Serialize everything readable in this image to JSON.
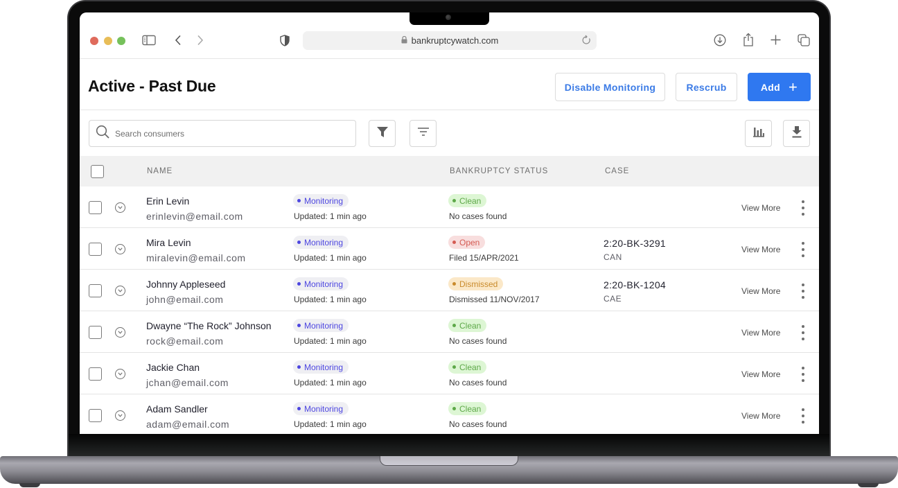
{
  "browser": {
    "url": "bankruptcywatch.com",
    "icons": {
      "sidebar": "sidebar-icon",
      "back": "chevron-left-icon",
      "forward": "chevron-right-icon",
      "privacy": "shield-icon",
      "lock": "lock-icon",
      "reload": "reload-icon",
      "downloads": "download-circle-icon",
      "share": "share-icon",
      "new_tab": "plus-icon",
      "tabs": "tabs-overview-icon"
    }
  },
  "header": {
    "title": "Active - Past Due",
    "disable_monitoring_label": "Disable Monitoring",
    "rescrub_label": "Rescrub",
    "add_label": "Add",
    "add_icon": "+"
  },
  "filters": {
    "search_placeholder": "Search consumers",
    "search_value": ""
  },
  "table": {
    "columns": [
      "NAME",
      "",
      "BANKRUPTCY STATUS",
      "CASE"
    ],
    "rows": [
      {
        "name": "Erin Levin",
        "email": "erinlevin@email.com",
        "monitoring": "Monitoring",
        "updated": "Updated: 1 min ago",
        "status": "Clean",
        "status_type": "clean",
        "status_detail": "No cases found",
        "case_number": "",
        "case_court": "",
        "action": "View More"
      },
      {
        "name": "Mira Levin",
        "email": "miralevin@email.com",
        "monitoring": "Monitoring",
        "updated": "Updated: 1 min ago",
        "status": "Open",
        "status_type": "open",
        "status_detail": "Filed 15/APR/2021",
        "case_number": "2:20-BK-3291",
        "case_court": "CAN",
        "action": "View More"
      },
      {
        "name": "Johnny Appleseed",
        "email": "john@email.com",
        "monitoring": "Monitoring",
        "updated": "Updated: 1 min ago",
        "status": "Dismissed",
        "status_type": "dismissed",
        "status_detail": "Dismissed 11/NOV/2017",
        "case_number": "2:20-BK-1204",
        "case_court": "CAE",
        "action": "View More"
      },
      {
        "name": "Dwayne “The Rock” Johnson",
        "email": "rock@email.com",
        "monitoring": "Monitoring",
        "updated": "Updated: 1 min ago",
        "status": "Clean",
        "status_type": "clean",
        "status_detail": "No cases found",
        "case_number": "",
        "case_court": "",
        "action": "View More"
      },
      {
        "name": "Jackie Chan",
        "email": "jchan@email.com",
        "monitoring": "Monitoring",
        "updated": "Updated: 1 min ago",
        "status": "Clean",
        "status_type": "clean",
        "status_detail": "No cases found",
        "case_number": "",
        "case_court": "",
        "action": "View More"
      },
      {
        "name": "Adam Sandler",
        "email": "adam@email.com",
        "monitoring": "Monitoring",
        "updated": "Updated: 1 min ago",
        "status": "Clean",
        "status_type": "clean",
        "status_detail": "No cases found",
        "case_number": "",
        "case_court": "",
        "action": "View More"
      }
    ]
  },
  "colors": {
    "primary": "#2f78f0",
    "monitoring": "#4d46e0",
    "clean": "#5da848",
    "open": "#d45a52",
    "dismissed": "#c98a2b"
  }
}
